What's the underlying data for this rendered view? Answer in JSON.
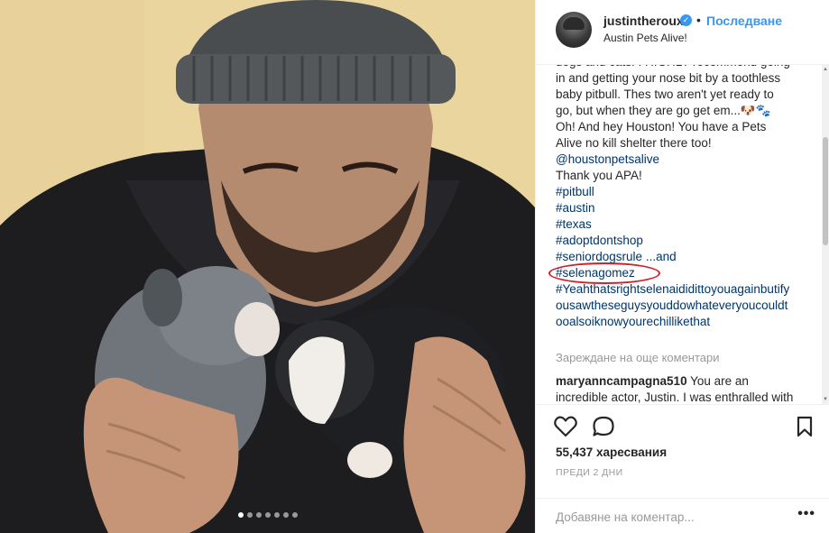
{
  "post": {
    "username": "justintheroux",
    "separator": "•",
    "follow_label": "Последване",
    "location": "Austin Pets Alive!",
    "image_alt": "Man in grey beanie holding two puppies",
    "carousel_dot_count": 7,
    "carousel_active_index": 0
  },
  "caption": {
    "lines": [
      "dogs and cats. I HIGHLY recommend going",
      "in and getting your nose bit by a toothless",
      "baby pitbull. Thes two aren't yet ready to",
      "go, but when they are go get em...🐶🐾",
      "Oh! And hey Houston! You have a Pets",
      "Alive no kill shelter there too!",
      "@houstonpetsalive",
      "Thank you APA!",
      "#pitbull",
      "#austin",
      "#texas",
      "#adoptdontshop",
      "#seniordogsrule ...and",
      "#selenagomez",
      "#Yeahthatsrightselenaididittoyouagainbutify",
      "ousawtheseguysyouddowhateveryoucouldt",
      "ooalsoiknowyourechillikethat"
    ],
    "partial_top_line": "dogs and cats."
  },
  "comments": {
    "load_more_label": "Зареждане на още коментари",
    "items": [
      {
        "author": "maryanncampagna510",
        "text": "You are an incredible actor, Justin. I was enthralled with"
      }
    ]
  },
  "actions": {
    "likes_label": "55,437 харесвания",
    "time_label": "ПРЕДИ 2 ДНИ",
    "add_comment_placeholder": "Добавяне на коментар...",
    "more_label": "•••"
  },
  "colors": {
    "link": "#003569",
    "follow": "#3897f0",
    "highlight_circle": "#d0202a",
    "muted": "#999999"
  },
  "icons": {
    "like": "heart-outline-icon",
    "comment": "speech-bubble-icon",
    "save": "bookmark-icon",
    "verified": "verified-badge-icon"
  }
}
